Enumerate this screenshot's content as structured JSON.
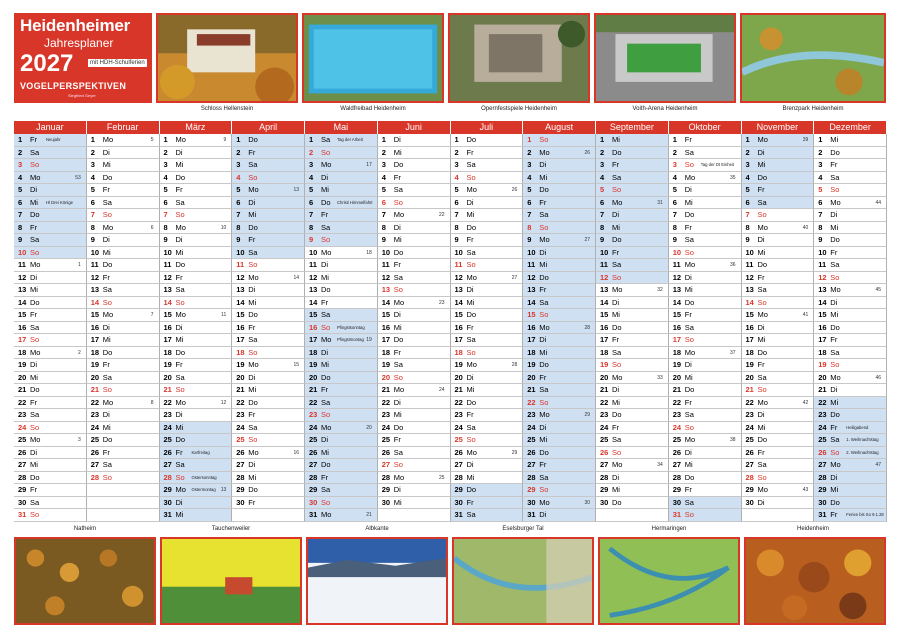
{
  "brand": {
    "title": "Heidenheimer",
    "subtitle": "Jahresplaner",
    "year": "2027",
    "badge": "mit HDH-Schulferien",
    "tagline": "VOGELPERSPEKTIVEN",
    "author": "Siegfried Geyer"
  },
  "top_photos": [
    {
      "caption": "Schloss Hellenstein"
    },
    {
      "caption": "Waldfreibad Heidenheim"
    },
    {
      "caption": "Opernfestspiele Heidenheim"
    },
    {
      "caption": "Voith-Arena Heidenheim"
    },
    {
      "caption": "Brenzpark Heidenheim"
    }
  ],
  "bottom_photos": [
    {
      "caption": "Natheim"
    },
    {
      "caption": "Tauchenweiler"
    },
    {
      "caption": "Albkante"
    },
    {
      "caption": "Eselsburger Tal"
    },
    {
      "caption": "Hermaringen"
    },
    {
      "caption": "Heidenheim"
    }
  ],
  "months": [
    {
      "name": "Januar",
      "start": 4,
      "days": 31,
      "hl": [
        1,
        2,
        3,
        4,
        5,
        6,
        7,
        8,
        9,
        10
      ]
    },
    {
      "name": "Februar",
      "start": 0,
      "days": 28,
      "hl": []
    },
    {
      "name": "März",
      "start": 0,
      "days": 31,
      "hl": [
        24,
        25,
        26,
        27,
        28,
        29,
        30,
        31
      ]
    },
    {
      "name": "April",
      "start": 3,
      "days": 30,
      "hl": [
        1,
        2,
        3,
        4,
        5,
        6,
        7,
        8,
        9,
        10
      ]
    },
    {
      "name": "Mai",
      "start": 5,
      "days": 31,
      "hl": [
        1,
        2,
        3,
        4,
        5,
        6,
        7,
        8,
        9,
        15,
        16,
        17,
        18,
        19,
        20,
        21,
        22,
        23,
        24,
        25,
        26,
        27,
        28,
        29,
        30,
        31
      ]
    },
    {
      "name": "Juni",
      "start": 1,
      "days": 30,
      "hl": []
    },
    {
      "name": "Juli",
      "start": 3,
      "days": 31,
      "hl": [
        29,
        30,
        31
      ]
    },
    {
      "name": "August",
      "start": 6,
      "days": 31,
      "hl": [
        1,
        2,
        3,
        4,
        5,
        6,
        7,
        8,
        9,
        10,
        11,
        12,
        13,
        14,
        15,
        16,
        17,
        18,
        19,
        20,
        21,
        22,
        23,
        24,
        25,
        26,
        27,
        28,
        29,
        30,
        31
      ]
    },
    {
      "name": "September",
      "start": 2,
      "days": 30,
      "hl": [
        1,
        2,
        3,
        4,
        5,
        6,
        7,
        8,
        9,
        10,
        11,
        12
      ]
    },
    {
      "name": "Oktober",
      "start": 4,
      "days": 31,
      "hl": [
        30,
        31
      ]
    },
    {
      "name": "November",
      "start": 0,
      "days": 30,
      "hl": [
        1,
        2,
        3,
        4,
        5,
        6
      ]
    },
    {
      "name": "Dezember",
      "start": 2,
      "days": 31,
      "hl": [
        22,
        23,
        24,
        25,
        26,
        27,
        28,
        29,
        30,
        31
      ]
    }
  ],
  "weekday_abbr": [
    "Mo",
    "Di",
    "Mi",
    "Do",
    "Fr",
    "Sa",
    "So"
  ],
  "holidays": {
    "0-1": "Neujahr",
    "0-6": "Hl Drei Könige",
    "2-26": "Karfreitag",
    "2-28": "Ostersonntag",
    "2-29": "Ostermontag",
    "4-1": "Tag der Arbeit",
    "4-6": "Christi Himmelfahrt",
    "4-16": "Pfingstsonntag",
    "4-17": "Pfingstmontag",
    "9-3": "Tag der Dt Einheit",
    "11-24": "Heiligabend",
    "11-25": "1. Weihnachtstag",
    "11-26": "2. Weihnachtstag",
    "11-31": "Ferien bis So 9.1.28"
  },
  "week_numbers_start": [
    53,
    5,
    9,
    13,
    17,
    22,
    26,
    26,
    31,
    35,
    39,
    44
  ]
}
